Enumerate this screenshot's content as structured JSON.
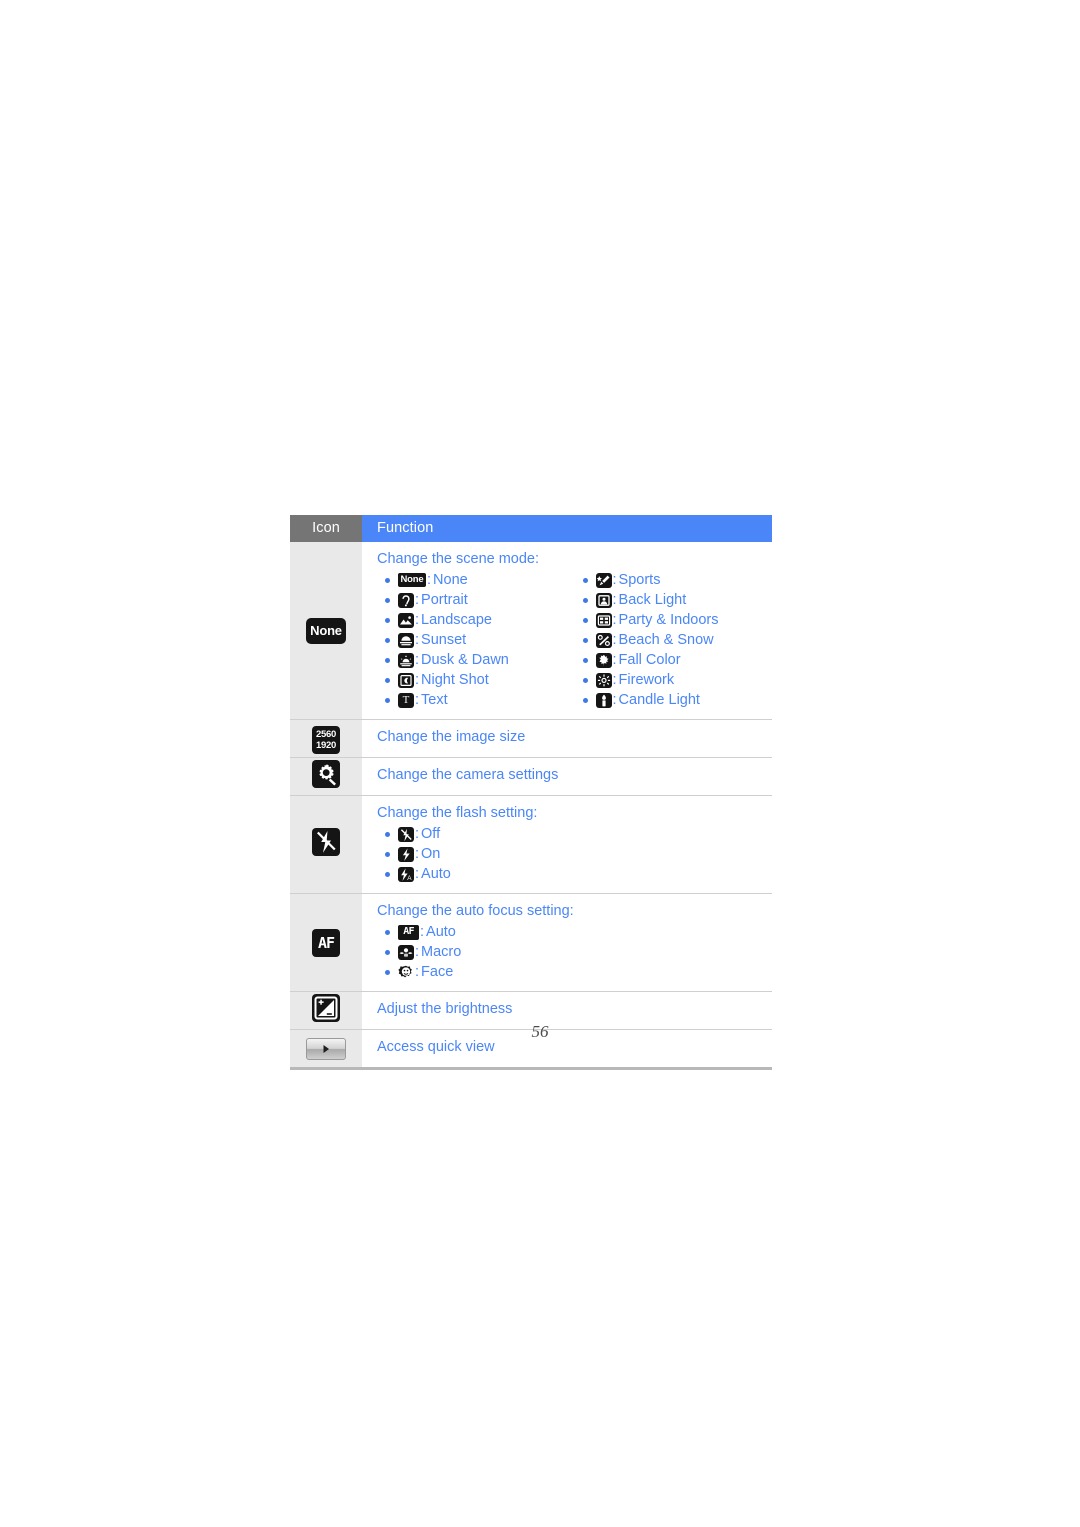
{
  "page": {
    "number": "56"
  },
  "table": {
    "header": {
      "icon_label": "Icon",
      "function_label": "Function"
    },
    "rows": [
      {
        "icon_name": "scene-mode-none-icon",
        "icon_text": "None",
        "heading": "Change the scene mode:",
        "options_left": [
          {
            "icon": "scene-none-icon",
            "icon_text": "None",
            "label": "None"
          },
          {
            "icon": "scene-portrait-icon",
            "icon_text": "",
            "label": "Portrait"
          },
          {
            "icon": "scene-landscape-icon",
            "icon_text": "",
            "label": "Landscape"
          },
          {
            "icon": "scene-sunset-icon",
            "icon_text": "",
            "label": "Sunset"
          },
          {
            "icon": "scene-dusk-dawn-icon",
            "icon_text": "",
            "label": "Dusk & Dawn"
          },
          {
            "icon": "scene-night-shot-icon",
            "icon_text": "",
            "label": "Night Shot"
          },
          {
            "icon": "scene-text-icon",
            "icon_text": "T",
            "label": "Text"
          }
        ],
        "options_right": [
          {
            "icon": "scene-sports-icon",
            "icon_text": "",
            "label": "Sports"
          },
          {
            "icon": "scene-back-light-icon",
            "icon_text": "",
            "label": "Back Light"
          },
          {
            "icon": "scene-party-indoors-icon",
            "icon_text": "",
            "label": "Party & Indoors"
          },
          {
            "icon": "scene-beach-snow-icon",
            "icon_text": "",
            "label": "Beach & Snow"
          },
          {
            "icon": "scene-fall-color-icon",
            "icon_text": "",
            "label": "Fall Color"
          },
          {
            "icon": "scene-firework-icon",
            "icon_text": "",
            "label": "Firework"
          },
          {
            "icon": "scene-candle-light-icon",
            "icon_text": "",
            "label": "Candle Light"
          }
        ]
      },
      {
        "icon_name": "image-size-icon",
        "icon_text_top": "2560",
        "icon_text_bottom": "1920",
        "heading": "Change the image size",
        "options": []
      },
      {
        "icon_name": "camera-settings-icon",
        "heading": "Change the camera settings",
        "options": []
      },
      {
        "icon_name": "flash-setting-icon",
        "heading": "Change the flash setting:",
        "options": [
          {
            "icon": "flash-off-icon",
            "label": "Off"
          },
          {
            "icon": "flash-on-icon",
            "label": "On"
          },
          {
            "icon": "flash-auto-icon",
            "label": "Auto"
          }
        ]
      },
      {
        "icon_name": "auto-focus-icon",
        "icon_text": "AF",
        "heading": "Change the auto focus setting:",
        "options": [
          {
            "icon": "focus-auto-icon",
            "icon_text": "AF",
            "label": "Auto"
          },
          {
            "icon": "focus-macro-icon",
            "icon_text": "",
            "label": "Macro"
          },
          {
            "icon": "focus-face-icon",
            "icon_text": "",
            "label": "Face"
          }
        ]
      },
      {
        "icon_name": "brightness-icon",
        "heading": "Adjust the brightness",
        "options": []
      },
      {
        "icon_name": "quick-view-icon",
        "heading": "Access quick view",
        "options": []
      }
    ]
  },
  "colors": {
    "accent_blue": "#4a86f7",
    "header_gray": "#757575",
    "icon_column_gray": "#e9e9e9",
    "icon_chip_black": "#151515",
    "rule_gray": "#cfcfcf"
  }
}
